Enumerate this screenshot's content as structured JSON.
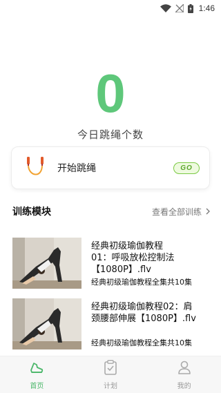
{
  "status_bar": {
    "time": "1:46",
    "icons": [
      "wifi-icon",
      "no-signal-icon",
      "battery-charging-icon"
    ]
  },
  "today": {
    "count": "0",
    "label": "今日跳绳个数"
  },
  "start_card": {
    "label": "开始跳绳",
    "badge": "GO",
    "icon": "jump-rope-icon"
  },
  "section": {
    "title": "训练模块",
    "more": "查看全部训练"
  },
  "courses": [
    {
      "title_line1": "经典初级瑜伽教程",
      "title_line2": "01：呼吸放松控制法",
      "title_line3": "【1080P】.flv",
      "subtitle": "经典初级瑜伽教程全集共10集"
    },
    {
      "title_line1": "经典初级瑜伽教程02：肩",
      "title_line2": "颈腰部伸展【1080P】.flv",
      "title_line3": "",
      "subtitle": "经典初级瑜伽教程全集共10集"
    }
  ],
  "nav": [
    {
      "label": "首页",
      "icon": "home-shoe-icon",
      "active": true
    },
    {
      "label": "计划",
      "icon": "clipboard-icon",
      "active": false
    },
    {
      "label": "我的",
      "icon": "user-icon",
      "active": false
    }
  ],
  "colors": {
    "accent": "#5ec77a",
    "go_border": "#7ac943",
    "nav_inactive": "#999999"
  }
}
